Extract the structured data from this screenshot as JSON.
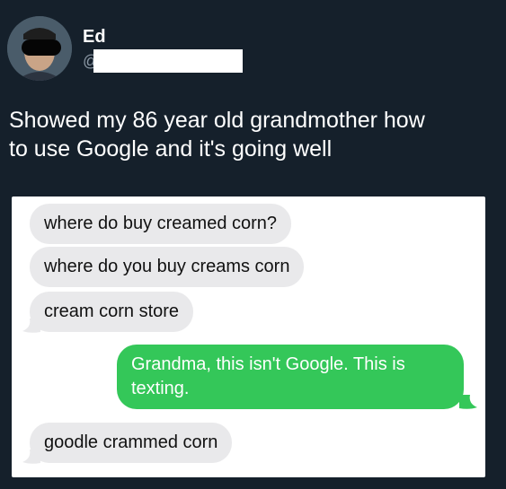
{
  "author": {
    "name": "Ed",
    "handle_prefix": "@"
  },
  "tweet": {
    "text_line1": "Showed my 86 year old grandmother how",
    "text_line2": "to use Google and it's going well"
  },
  "messages": [
    {
      "direction": "incoming",
      "text": "where do buy creamed corn?"
    },
    {
      "direction": "incoming",
      "text": "where do you buy creams corn"
    },
    {
      "direction": "incoming",
      "text": "cream corn store"
    },
    {
      "direction": "outgoing",
      "text_line1": "Grandma, this isn't Google. This is",
      "text_line2": "texting."
    },
    {
      "direction": "incoming",
      "text": "goodle crammed corn"
    }
  ],
  "colors": {
    "background": "#15202b",
    "incoming_bubble": "#e9e9eb",
    "outgoing_bubble": "#34c759",
    "redaction": "#ffffff"
  },
  "icons": {
    "avatar": "profile-photo-avatar"
  }
}
